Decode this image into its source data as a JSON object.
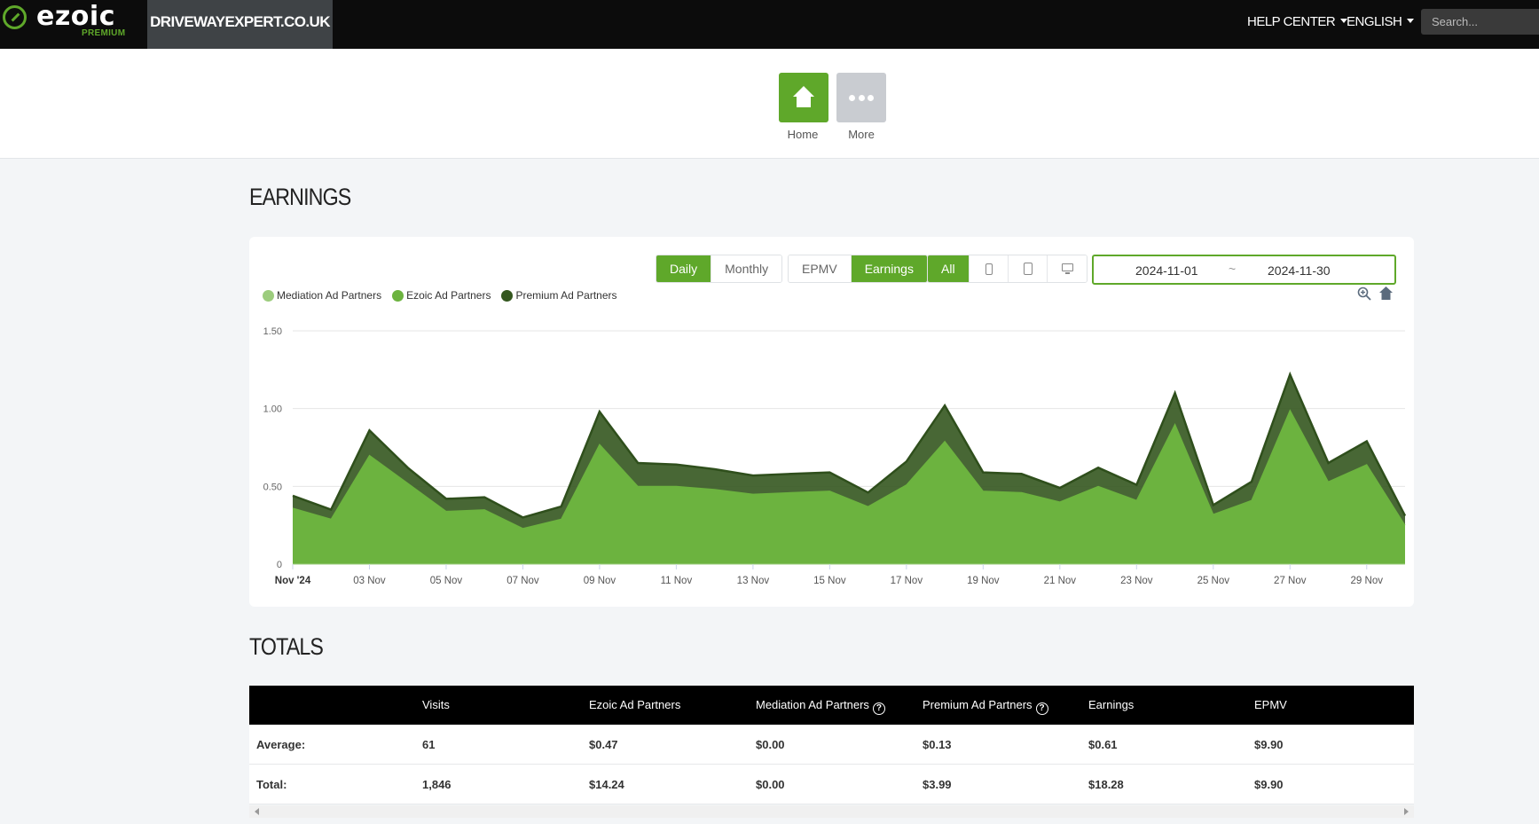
{
  "brand": {
    "name": "ezoic",
    "tier": "PREMIUM"
  },
  "site": {
    "name": "DRIVEWAYEXPERT.CO.UK"
  },
  "topnav": {
    "help": "HELP CENTER",
    "language": "ENGLISH",
    "search_placeholder": "Search..."
  },
  "iconnav": {
    "home": "Home",
    "more": "More"
  },
  "page": {
    "earnings_title": "EARNINGS",
    "totals_title": "TOTALS"
  },
  "controls": {
    "period": [
      "Daily",
      "Monthly"
    ],
    "period_active": "Daily",
    "metric": [
      "EPMV",
      "Earnings"
    ],
    "metric_active": "Earnings",
    "device_all": "All",
    "device_icons": [
      "phone-icon",
      "tablet-icon",
      "desktop-icon"
    ],
    "date_from": "2024-11-01",
    "date_sep": "~",
    "date_to": "2024-11-30"
  },
  "colors": {
    "accent": "#5fa82a",
    "mediation": "#9ccc7d",
    "ezoic": "#6cb33f",
    "premium": "#34571f",
    "header_bg": "#0c0c0c"
  },
  "chart_data": {
    "type": "area",
    "stacked": true,
    "legend": [
      "Mediation Ad Partners",
      "Ezoic Ad Partners",
      "Premium Ad Partners"
    ],
    "legend_position": "top-left",
    "x": [
      "01 Nov",
      "02 Nov",
      "03 Nov",
      "04 Nov",
      "05 Nov",
      "06 Nov",
      "07 Nov",
      "08 Nov",
      "09 Nov",
      "10 Nov",
      "11 Nov",
      "12 Nov",
      "13 Nov",
      "14 Nov",
      "15 Nov",
      "16 Nov",
      "17 Nov",
      "18 Nov",
      "19 Nov",
      "20 Nov",
      "21 Nov",
      "22 Nov",
      "23 Nov",
      "24 Nov",
      "25 Nov",
      "26 Nov",
      "27 Nov",
      "28 Nov",
      "29 Nov",
      "30 Nov"
    ],
    "x_tick_labels": [
      "Nov '24",
      "03 Nov",
      "05 Nov",
      "07 Nov",
      "09 Nov",
      "11 Nov",
      "13 Nov",
      "15 Nov",
      "17 Nov",
      "19 Nov",
      "21 Nov",
      "23 Nov",
      "25 Nov",
      "27 Nov",
      "29 Nov"
    ],
    "y_tick_labels": [
      "0",
      "0.50",
      "1.00",
      "1.50"
    ],
    "ylim": [
      0,
      1.5
    ],
    "grid": true,
    "series": [
      {
        "name": "Mediation Ad Partners",
        "values": [
          0,
          0,
          0,
          0,
          0,
          0,
          0,
          0,
          0,
          0,
          0,
          0,
          0,
          0,
          0,
          0,
          0,
          0,
          0,
          0,
          0,
          0,
          0,
          0,
          0,
          0,
          0,
          0,
          0,
          0
        ]
      },
      {
        "name": "Ezoic Ad Partners",
        "values": [
          0.36,
          0.29,
          0.7,
          0.52,
          0.34,
          0.35,
          0.23,
          0.29,
          0.77,
          0.5,
          0.5,
          0.48,
          0.45,
          0.46,
          0.47,
          0.37,
          0.51,
          0.79,
          0.47,
          0.46,
          0.4,
          0.5,
          0.41,
          0.9,
          0.32,
          0.41,
          0.99,
          0.53,
          0.64,
          0.25
        ]
      },
      {
        "name": "Premium Ad Partners",
        "values": [
          0.08,
          0.06,
          0.16,
          0.1,
          0.08,
          0.08,
          0.07,
          0.08,
          0.21,
          0.15,
          0.14,
          0.13,
          0.12,
          0.12,
          0.12,
          0.09,
          0.15,
          0.23,
          0.12,
          0.12,
          0.09,
          0.12,
          0.1,
          0.2,
          0.06,
          0.12,
          0.23,
          0.12,
          0.15,
          0.06
        ]
      }
    ]
  },
  "totals": {
    "columns": [
      "",
      "Visits",
      "Ezoic Ad Partners",
      "Mediation Ad Partners",
      "Premium Ad Partners",
      "Earnings",
      "EPMV"
    ],
    "rows": [
      {
        "label": "Average:",
        "values": [
          "61",
          "$0.47",
          "$0.00",
          "$0.13",
          "$0.61",
          "$9.90"
        ]
      },
      {
        "label": "Total:",
        "values": [
          "1,846",
          "$14.24",
          "$0.00",
          "$3.99",
          "$18.28",
          "$9.90"
        ]
      }
    ]
  }
}
